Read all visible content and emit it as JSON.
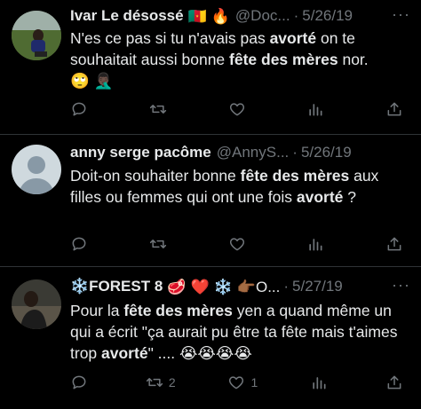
{
  "tweets": [
    {
      "name": "Ivar Le désossé",
      "name_emojis": [
        "🇨🇲",
        "🔥"
      ],
      "handle": "@Doc...",
      "sep": "·",
      "date": "5/26/19",
      "more": "···",
      "text_parts": [
        {
          "t": "N'es ce pas si tu n'avais pas ",
          "b": false
        },
        {
          "t": "avorté",
          "b": true
        },
        {
          "t": " on te souhaitait aussi bonne ",
          "b": false
        },
        {
          "t": "fête des mères",
          "b": true
        },
        {
          "t": " nor.",
          "b": false
        }
      ],
      "text_emojis": [
        "🙄",
        "🤦🏿‍♂️"
      ],
      "actions": {
        "reply": "",
        "retweet": "",
        "like": "",
        "views": "",
        "share": ""
      }
    },
    {
      "name": "anny serge pacôme",
      "name_emojis": [],
      "handle": "@AnnyS...",
      "sep": "·",
      "date": "5/26/19",
      "more": "···",
      "text_parts": [
        {
          "t": "Doit-on souhaiter bonne ",
          "b": false
        },
        {
          "t": "fête des mères",
          "b": true
        },
        {
          "t": " aux filles ou femmes qui ont une fois ",
          "b": false
        },
        {
          "t": "avorté",
          "b": true
        },
        {
          "t": " ?",
          "b": false
        }
      ],
      "text_emojis": [],
      "actions": {
        "reply": "",
        "retweet": "",
        "like": "",
        "views": "",
        "share": ""
      }
    },
    {
      "name": "❄️FOREST 8",
      "name_emojis": [
        "🥩",
        "❤️",
        "❄️",
        "👉🏾O..."
      ],
      "handle": "",
      "sep": "·",
      "date": "5/27/19",
      "more": "···",
      "text_parts": [
        {
          "t": "Pour la ",
          "b": false
        },
        {
          "t": "fête des mères",
          "b": true
        },
        {
          "t": " yen a quand même un qui a écrit \"ça aurait pu être ta fête mais t'aimes trop ",
          "b": false
        },
        {
          "t": "avorté",
          "b": true
        },
        {
          "t": "\" .... ",
          "b": false
        }
      ],
      "text_emojis": [
        "😭",
        "😭",
        "😭",
        "😭"
      ],
      "actions": {
        "reply": "",
        "retweet": "2",
        "like": "1",
        "views": "",
        "share": ""
      }
    }
  ],
  "colors": {
    "background": "#000000",
    "text": "#e7e9ea",
    "secondary": "#71767b",
    "divider": "#2f3336"
  },
  "icons": [
    "reply-icon",
    "retweet-icon",
    "like-icon",
    "views-icon",
    "share-icon",
    "more-icon"
  ]
}
